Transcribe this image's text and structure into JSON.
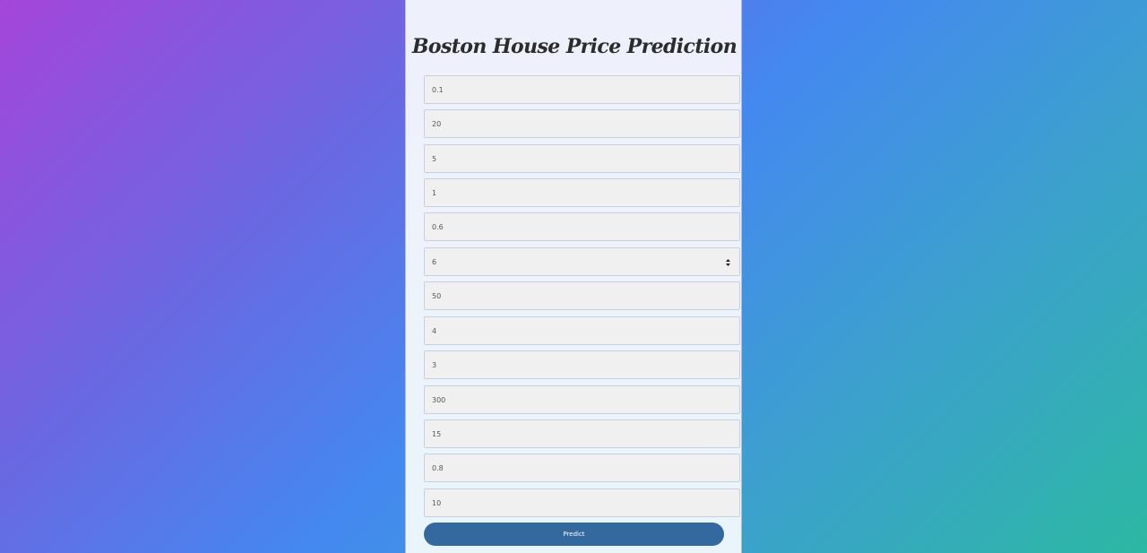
{
  "form": {
    "title": "Boston House Price Prediction",
    "fields": [
      {
        "value": "0.1"
      },
      {
        "value": "20"
      },
      {
        "value": "5"
      },
      {
        "value": "1"
      },
      {
        "value": "0.6"
      },
      {
        "value": "6",
        "type": "select"
      },
      {
        "value": "50"
      },
      {
        "value": "4"
      },
      {
        "value": "3"
      },
      {
        "value": "300"
      },
      {
        "value": "15"
      },
      {
        "value": "0.8"
      },
      {
        "value": "10"
      }
    ],
    "submit_label": "Predict"
  },
  "colors": {
    "button_bg": "#33699e",
    "card_bg": "#eef0fb",
    "field_bg": "#f0f0f0",
    "title_text": "#2c2c2c"
  },
  "icons": {
    "select_caret": "up-down-caret-icon"
  }
}
